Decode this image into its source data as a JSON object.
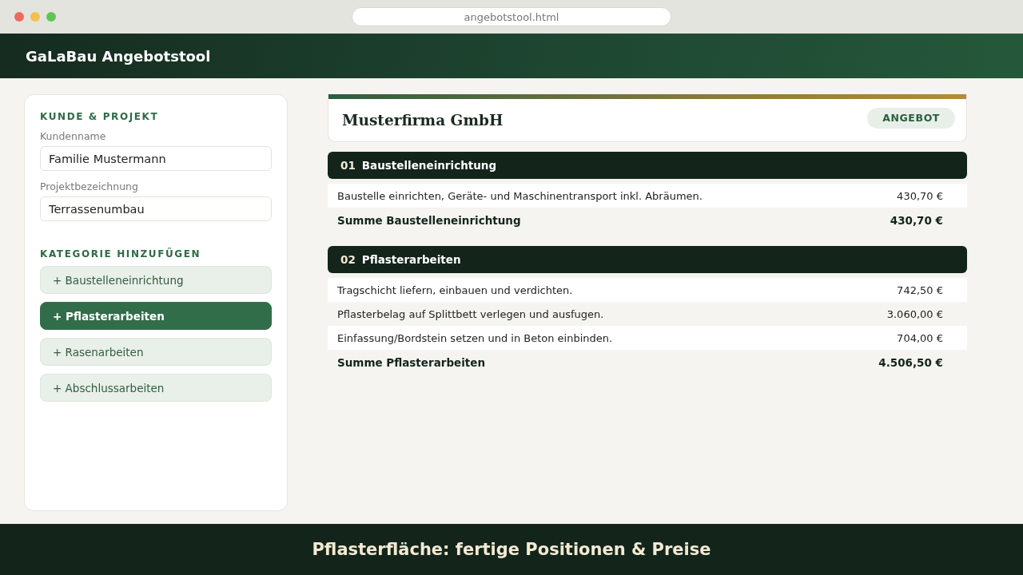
{
  "browser": {
    "url": "angebotstool.html"
  },
  "header": {
    "title": "GaLaBau Angebotstool"
  },
  "sidebar": {
    "customer_section": {
      "heading": "KUNDE & PROJEKT",
      "fields": [
        {
          "label": "Kundenname",
          "value": "Familie Mustermann"
        },
        {
          "label": "Projektbezeichnung",
          "value": "Terrassenumbau"
        }
      ]
    },
    "category_section": {
      "heading": "KATEGORIE HINZUFÜGEN",
      "buttons": [
        {
          "label": "+ Baustelleneinrichtung",
          "selected": false
        },
        {
          "label": "+ Pflasterarbeiten",
          "selected": true
        },
        {
          "label": "+ Rasenarbeiten",
          "selected": false
        },
        {
          "label": "+ Abschlussarbeiten",
          "selected": false
        }
      ]
    }
  },
  "offer": {
    "company": "Musterfirma GmbH",
    "badge": "ANGEBOT",
    "sections": [
      {
        "number": "01",
        "title": "Baustelleneinrichtung",
        "items": [
          {
            "description": "Baustelle einrichten, Geräte- und Maschinentransport inkl. Abräumen.",
            "price": "430,70 €"
          }
        ],
        "total_label": "Summe Baustelleneinrichtung",
        "total": "430,70 €"
      },
      {
        "number": "02",
        "title": "Pflasterarbeiten",
        "items": [
          {
            "description": "Tragschicht liefern, einbauen und verdichten.",
            "price": "742,50 €"
          },
          {
            "description": "Pflasterbelag auf Splittbett verlegen und ausfugen.",
            "price": "3.060,00 €"
          },
          {
            "description": "Einfassung/Bordstein setzen und in Beton einbinden.",
            "price": "704,00 €"
          }
        ],
        "total_label": "Summe Pflasterarbeiten",
        "total": "4.506,50 €"
      }
    ]
  },
  "caption": "Pflasterfläche: fertige Positionen & Preise"
}
